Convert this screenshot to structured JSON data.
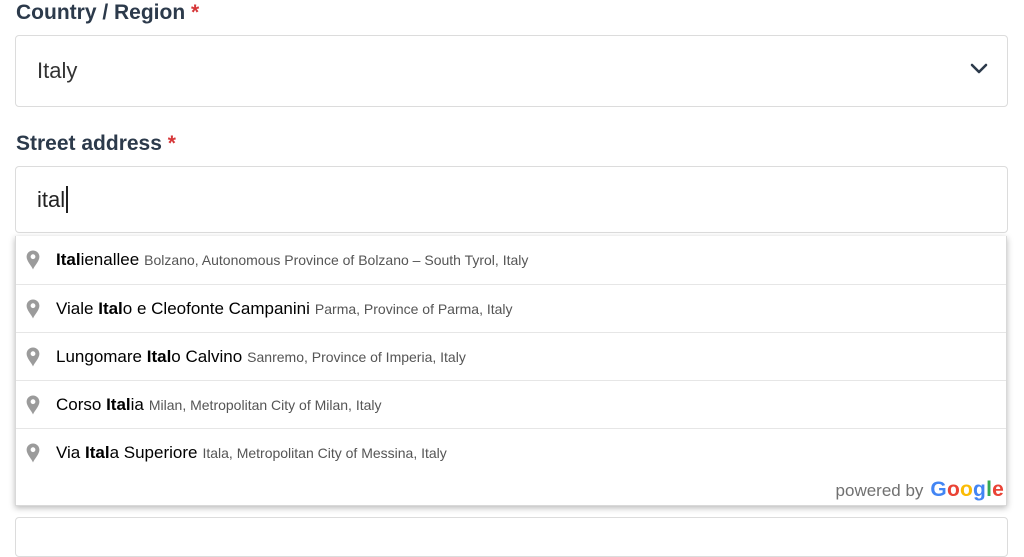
{
  "country_field": {
    "label": "Country / Region",
    "required_mark": "*",
    "value": "Italy"
  },
  "street_field": {
    "label": "Street address",
    "required_mark": "*",
    "value": "ital"
  },
  "suggestions": [
    {
      "before": "",
      "match": "Ital",
      "after": "ienallee",
      "secondary": "Bolzano, Autonomous Province of Bolzano – South Tyrol, Italy"
    },
    {
      "before": "Viale ",
      "match": "Ital",
      "after": "o e Cleofonte Campanini",
      "secondary": "Parma, Province of Parma, Italy"
    },
    {
      "before": "Lungomare ",
      "match": "Ital",
      "after": "o Calvino",
      "secondary": "Sanremo, Province of Imperia, Italy"
    },
    {
      "before": "Corso ",
      "match": "Ital",
      "after": "ia",
      "secondary": "Milan, Metropolitan City of Milan, Italy"
    },
    {
      "before": "Via ",
      "match": "Ital",
      "after": "a Superiore",
      "secondary": "Itala, Metropolitan City of Messina, Italy"
    }
  ],
  "attribution": {
    "prefix": "powered by",
    "brand": [
      "G",
      "o",
      "o",
      "g",
      "l",
      "e"
    ]
  },
  "colors": {
    "label": "#2c3a4b",
    "required": "#d63638",
    "google_letters": [
      "#4285F4",
      "#EA4335",
      "#FBBC05",
      "#4285F4",
      "#34A853",
      "#EA4335"
    ]
  },
  "icons": {
    "suggestion": "map-pin-icon",
    "select": "chevron-down-icon"
  }
}
